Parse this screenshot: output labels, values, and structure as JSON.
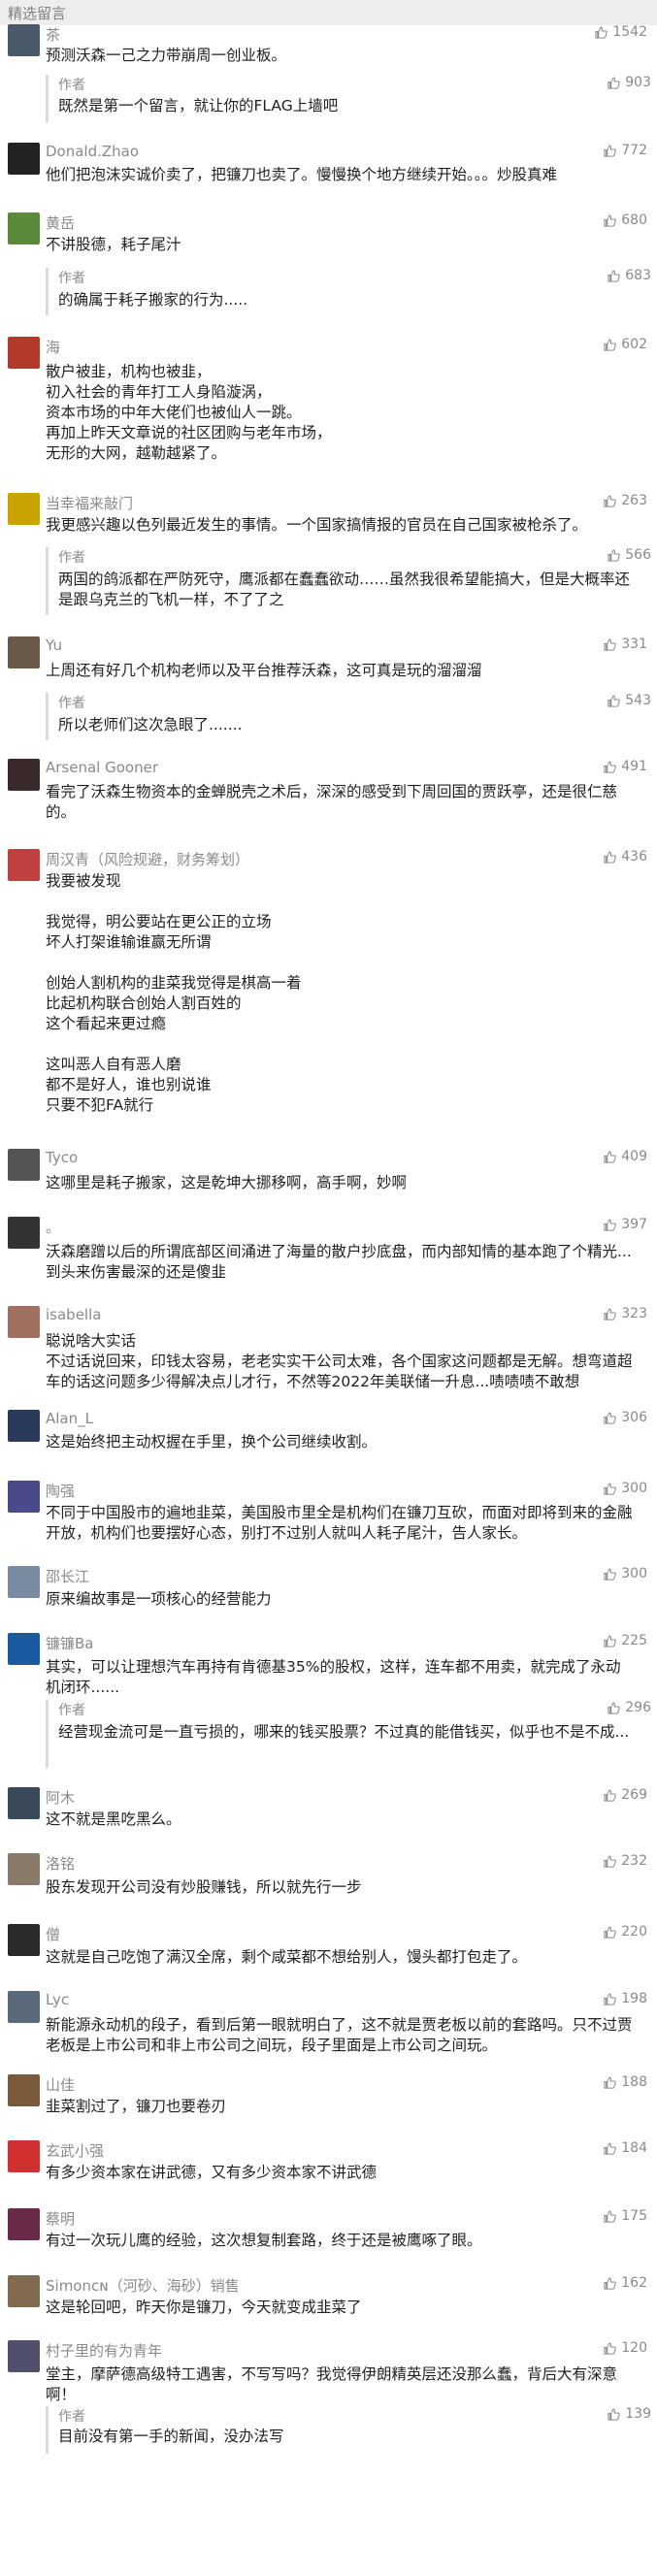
{
  "section_title": "精选留言",
  "colors": {
    "background": "#ededed",
    "card": "#ffffff",
    "meta_text": "#8a8a8a",
    "reply_bar": "#d9d9d9"
  },
  "comments": [
    {
      "nick": "茶",
      "likes": "1542",
      "text": "预测沃森一己之力带崩周一创业板。",
      "reply": {
        "label": "作者",
        "likes": "903",
        "text": "既然是第一个留言，就让你的FLAG上墙吧"
      }
    },
    {
      "nick": "Donald.Zhao",
      "likes": "772",
      "text": "他们把泡沫实诚价卖了，把镰刀也卖了。慢慢换个地方继续开始。。。炒股真难"
    },
    {
      "nick": "黄岳",
      "likes": "680",
      "text": "不讲股德，耗子尾汁",
      "reply": {
        "label": "作者",
        "likes": "683",
        "text": "的确属于耗子搬家的行为....."
      }
    },
    {
      "nick": "海",
      "likes": "602",
      "text": "散户被韭，机构也被韭，\n初入社会的青年打工人身陷漩涡，\n资本市场的中年大佬们也被仙人一跳。\n再加上昨天文章说的社区团购与老年市场，\n无形的大网，越勒越紧了。"
    },
    {
      "nick": "当幸福来敲门",
      "likes": "263",
      "text": "我更感兴趣以色列最近发生的事情。一个国家搞情报的官员在自己国家被枪杀了。",
      "reply": {
        "label": "作者",
        "likes": "566",
        "text": "两国的鸽派都在严防死守，鹰派都在蠢蠢欲动……虽然我很希望能搞大，但是大概率还是跟乌克兰的飞机一样，不了了之"
      }
    },
    {
      "nick": "Yu",
      "likes": "331",
      "text": "上周还有好几个机构老师以及平台推荐沃森，这可真是玩的溜溜溜",
      "reply": {
        "label": "作者",
        "likes": "543",
        "text": "所以老师们这次急眼了......."
      }
    },
    {
      "nick": "Arsenal Gooner",
      "likes": "491",
      "text": "看完了沃森生物资本的金蝉脱壳之术后，深深的感受到下周回国的贾跃亭，还是很仁慈的。"
    },
    {
      "nick": "周汉青（风险规避，财务筹划）",
      "likes": "436",
      "text": "我要被发现\n\n我觉得，明公要站在更公正的立场\n坏人打架谁输谁赢无所谓\n\n创始人割机构的韭菜我觉得是棋高一着\n比起机构联合创始人割百姓的\n这个看起来更过瘾\n\n这叫恶人自有恶人磨\n都不是好人，谁也别说谁\n只要不犯FA就行"
    },
    {
      "nick": "Tyco",
      "likes": "409",
      "text": "这哪里是耗子搬家，这是乾坤大挪移啊，高手啊，妙啊"
    },
    {
      "nick": "。",
      "likes": "397",
      "text": "沃森磨蹭以后的所谓底部区间涌进了海量的散户抄底盘，而内部知情的基本跑了个精光...到头来伤害最深的还是傻韭"
    },
    {
      "nick": "isabella",
      "likes": "323",
      "text": "聪说啥大实话\n不过话说回来，印钱太容易，老老实实干公司太难，各个国家这问题都是无解。想弯道超车的话这问题多少得解决点儿才行，不然等2022年美联储一升息...啧啧啧不敢想"
    },
    {
      "nick": "Alan_L",
      "likes": "306",
      "text": "这是始终把主动权握在手里，换个公司继续收割。"
    },
    {
      "nick": "陶强",
      "likes": "300",
      "text": "不同于中国股市的遍地韭菜，美国股市里全是机构们在镰刀互砍，而面对即将到来的金融开放，机构们也要摆好心态，别打不过别人就叫人耗子尾汁，告人家长。"
    },
    {
      "nick": "邵长江",
      "likes": "300",
      "text": "原来编故事是一项核心的经营能力"
    },
    {
      "nick": "镰镰Ba",
      "likes": "225",
      "text": "其实，可以让理想汽车再持有肯德基35%的股权，这样，连车都不用卖，就完成了永动机闭环......",
      "reply": {
        "label": "作者",
        "likes": "296",
        "text": "经营现金流可是一直亏损的，哪来的钱买股票？不过真的能借钱买，似乎也不是不成..."
      }
    },
    {
      "nick": "阿木",
      "likes": "269",
      "text": "这不就是黑吃黑么。"
    },
    {
      "nick": "洛铭",
      "likes": "232",
      "text": "股东发现开公司没有炒股赚钱，所以就先行一步"
    },
    {
      "nick": "僧",
      "likes": "220",
      "text": "这就是自己吃饱了满汉全席，剩个咸菜都不想给别人，馒头都打包走了。"
    },
    {
      "nick": "Lyc",
      "likes": "198",
      "text": "新能源永动机的段子，看到后第一眼就明白了，这不就是贾老板以前的套路吗。只不过贾老板是上市公司和非上市公司之间玩，段子里面是上市公司之间玩。"
    },
    {
      "nick": "山佳",
      "likes": "188",
      "text": "韭菜割过了，镰刀也要卷刃"
    },
    {
      "nick": "玄武小强",
      "likes": "184",
      "text": "有多少资本家在讲武德，又有多少资本家不讲武德"
    },
    {
      "nick": "蔡明",
      "likes": "175",
      "text": "有过一次玩儿鹰的经验，这次想复制套路，终于还是被鹰啄了眼。"
    },
    {
      "nick": "Simonᴄɴ（河砂、海砂）销售",
      "likes": "162",
      "text": "这是轮回吧，昨天你是镰刀，今天就变成韭菜了"
    },
    {
      "nick": "村子里的有为青年",
      "likes": "120",
      "text": "堂主，摩萨德高级特工遇害，不写写吗？我觉得伊朗精英层还没那么蠢，背后大有深意啊！",
      "reply": {
        "label": "作者",
        "likes": "139",
        "text": "目前没有第一手的新闻，没办法写"
      }
    }
  ]
}
